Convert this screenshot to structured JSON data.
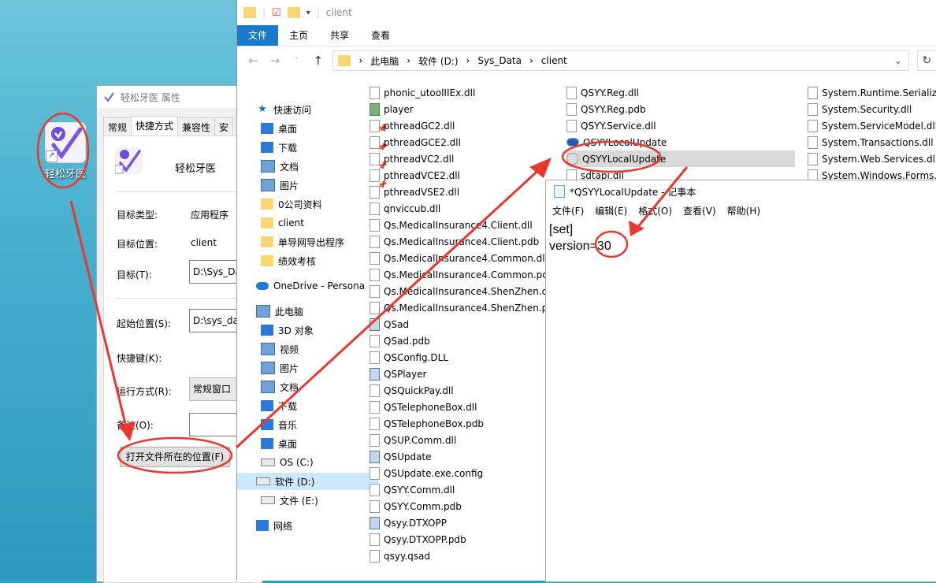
{
  "desktop": {
    "shortcut_label": "轻松牙医"
  },
  "properties": {
    "title": "轻松牙医 属性",
    "tabs": [
      "常规",
      "快捷方式",
      "兼容性",
      "安"
    ],
    "app_name": "轻松牙医",
    "target_type_label": "目标类型:",
    "target_type_value": "应用程序",
    "target_location_label": "目标位置:",
    "target_location_value": "client",
    "target_label": "目标(T):",
    "target_value": "D:\\Sys_Da",
    "start_in_label": "起始位置(S):",
    "start_in_value": "D:\\sys_dat",
    "hotkey_label": "快捷键(K):",
    "run_label": "运行方式(R):",
    "run_value": "常规窗口",
    "comment_label": "备注(O):",
    "open_location_button": "打开文件所在的位置(F)"
  },
  "explorer": {
    "qat_title": "client",
    "ribbon_tabs": [
      "文件",
      "主页",
      "共享",
      "查看"
    ],
    "breadcrumb": [
      "此电脑",
      "软件 (D:)",
      "Sys_Data",
      "client"
    ],
    "nav": [
      {
        "label": "快速访问",
        "icon": "star"
      },
      {
        "label": "桌面",
        "icon": "blue",
        "pin": true
      },
      {
        "label": "下载",
        "icon": "download",
        "pin": true
      },
      {
        "label": "文档",
        "icon": "doc",
        "pin": true
      },
      {
        "label": "图片",
        "icon": "pic",
        "pin": true
      },
      {
        "label": "0公司资料",
        "icon": "folder"
      },
      {
        "label": "client",
        "icon": "folder"
      },
      {
        "label": "单导网导出程序",
        "icon": "folder"
      },
      {
        "label": "绩效考核",
        "icon": "folder"
      },
      {
        "label": "OneDrive - Persona",
        "icon": "cloud"
      },
      {
        "label": "此电脑",
        "icon": "pc"
      },
      {
        "label": "3D 对象",
        "icon": "3d"
      },
      {
        "label": "视频",
        "icon": "video"
      },
      {
        "label": "图片",
        "icon": "pic"
      },
      {
        "label": "文档",
        "icon": "doc"
      },
      {
        "label": "下载",
        "icon": "download"
      },
      {
        "label": "音乐",
        "icon": "music"
      },
      {
        "label": "桌面",
        "icon": "blue"
      },
      {
        "label": "OS (C:)",
        "icon": "drive"
      },
      {
        "label": "软件 (D:)",
        "icon": "drive",
        "selected": true
      },
      {
        "label": "文件 (E:)",
        "icon": "drive"
      },
      {
        "label": "网络",
        "icon": "net"
      }
    ],
    "files_col1": [
      "phonic_utoolIIEx.dll",
      "player",
      "pthreadGC2.dll",
      "pthreadGCE2.dll",
      "pthreadVC2.dll",
      "pthreadVCE2.dll",
      "pthreadVSE2.dll",
      "qnviccub.dll",
      "Qs.MedicalInsurance4.Client.dll",
      "Qs.MedicalInsurance4.Client.pdb",
      "Qs.MedicalInsurance4.Common.dll",
      "Qs.MedicalInsurance4.Common.pdb",
      "Qs.MedicalInsurance4.ShenZhen.dll",
      "Qs.MedicalInsurance4.ShenZhen.pdb",
      "QSad",
      "QSad.pdb",
      "QSConfig.DLL",
      "QSPlayer",
      "QSQuickPay.dll",
      "QSTelephoneBox.dll",
      "QSTelephoneBox.pdb",
      "QSUP.Comm.dll",
      "QSUpdate",
      "QSUpdate.exe.config",
      "QSYY.Comm.dll",
      "QSYY.Comm.pdb",
      "Qsyy.DTXOPP",
      "Qsyy.DTXOPP.pdb",
      "qsyy.qsad"
    ],
    "files_col2": [
      "QSYY.Reg.dll",
      "QSYY.Reg.pdb",
      "QSYY.Service.dll",
      "QSYYLocalUpdate",
      "QSYYLocalUpdate",
      "sdtapi.dll"
    ],
    "files_col3": [
      "System.Runtime.Serializatio",
      "System.Security.dll",
      "System.ServiceModel.dll",
      "System.Transactions.dll",
      "System.Web.Services.dll",
      "System.Windows.Forms.Da"
    ]
  },
  "notepad": {
    "title": "*QSYYLocalUpdate - 记事本",
    "menu": [
      "文件(F)",
      "编辑(E)",
      "格式(O)",
      "查看(V)",
      "帮助(H)"
    ],
    "line1": "[set]",
    "line2_key": "version=",
    "line2_value": "30"
  },
  "colors": {
    "annotation": "#e8382f",
    "ribbon_file": "#1979ca",
    "selection": "#cce8ff"
  }
}
